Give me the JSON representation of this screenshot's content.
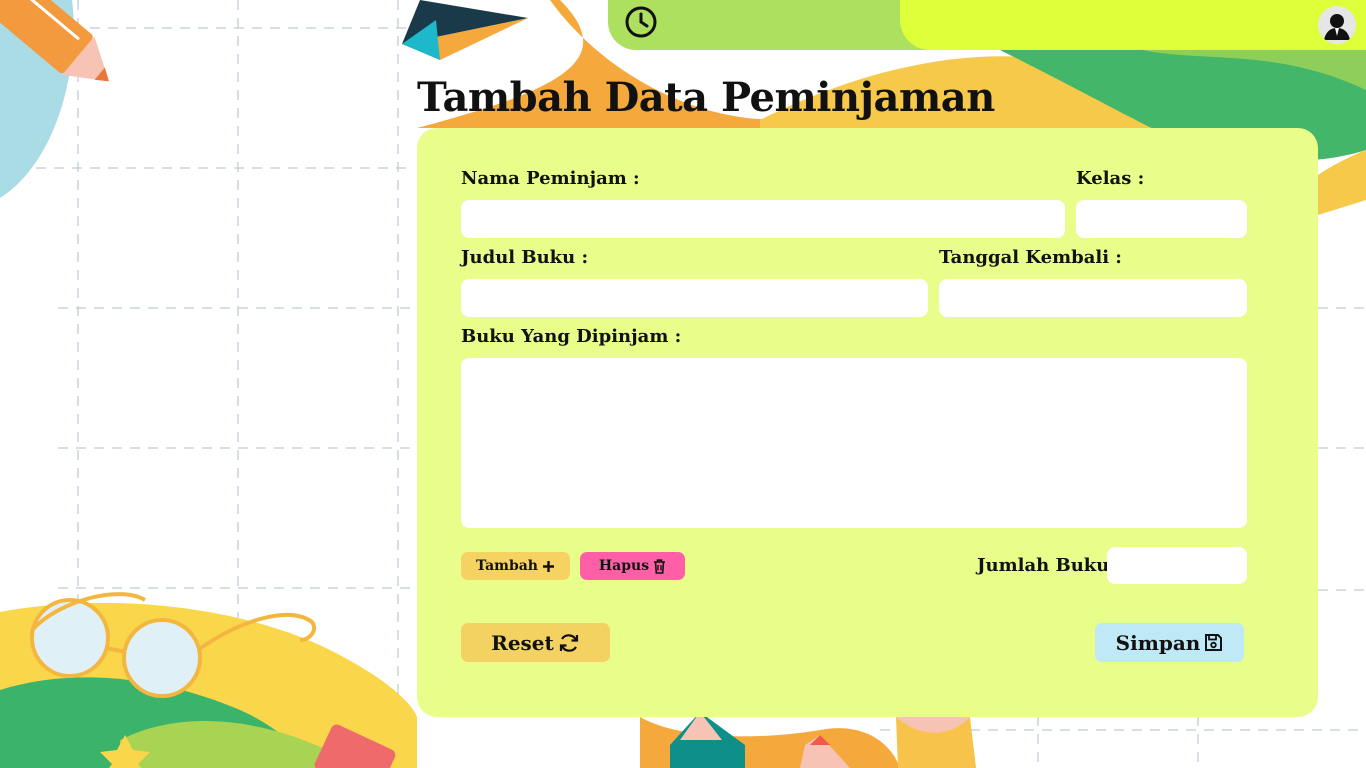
{
  "header": {
    "clock_icon": "clock-icon",
    "avatar_icon": "user-avatar-icon"
  },
  "page": {
    "title": "Tambah Data Peminjaman"
  },
  "form": {
    "nama_label": "Nama Peminjam :",
    "nama_value": "",
    "kelas_label": "Kelas :",
    "kelas_value": "",
    "judul_label": "Judul Buku :",
    "judul_value": "",
    "tanggal_label": "Tanggal Kembali :",
    "tanggal_value": "",
    "buku_label": "Buku Yang Dipinjam :",
    "buku_value": "",
    "jumlah_label": "Jumlah Buku :",
    "jumlah_value": ""
  },
  "buttons": {
    "tambah": "Tambah",
    "hapus": "Hapus",
    "reset": "Reset",
    "simpan": "Simpan"
  },
  "colors": {
    "card": "#e8fd8a",
    "topbar": "#aee060",
    "topbar_accent": "#ddff3a",
    "tambah": "#f6d263",
    "hapus": "#ff5fa7",
    "reset": "#f4d262",
    "simpan": "#bfe9f7"
  }
}
